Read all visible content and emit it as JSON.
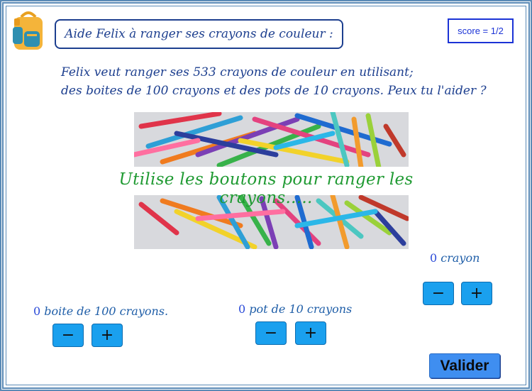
{
  "header": {
    "title": "Aide Felix à ranger ses crayons de couleur :",
    "score": "score = 1/2"
  },
  "problem": {
    "line1": "Felix veut ranger ses 533 crayons de couleur en utilisant;",
    "line2": "des boites de 100 crayons et des pots de 10 crayons. Peux tu l'aider ?"
  },
  "instruction": "Utilise les boutons pour ranger les crayons.....",
  "counters": {
    "boites": {
      "value": "0",
      "label": "boite de 100 crayons."
    },
    "pots": {
      "value": "0",
      "label": "pot de 10 crayons"
    },
    "crayons": {
      "value": "0",
      "label": "crayon"
    }
  },
  "buttons": {
    "minus": "−",
    "plus": "+",
    "validate": "Valider"
  },
  "icons": {
    "backpack": "backpack-icon",
    "photo": "colored-pencils-photo"
  },
  "colors": {
    "title_blue": "#1d3f8f",
    "score_blue": "#1b33d6",
    "instruction_green": "#1f9a32",
    "button_blue": "#1aa0ee",
    "validate_blue": "#3f8ef0"
  }
}
